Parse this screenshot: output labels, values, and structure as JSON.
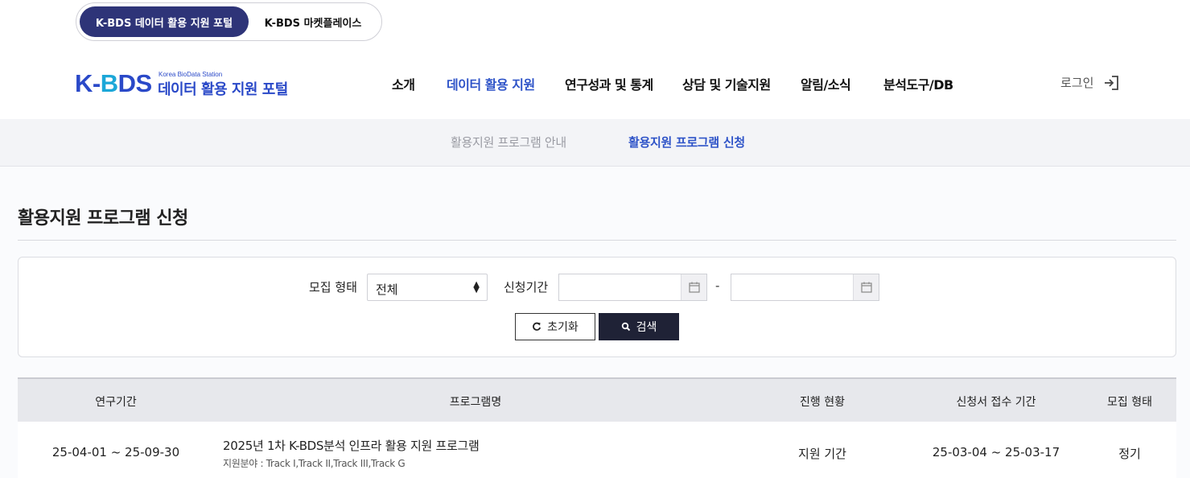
{
  "portal_switch": {
    "active_label": "K-BDS 데이터 활용 지원 포털",
    "other_label": "K-BDS 마켓플레이스"
  },
  "logo": {
    "mark": "K-BDS",
    "english": "Korea BioData Station",
    "korean": "데이터 활용 지원 포털"
  },
  "nav": {
    "items": [
      {
        "label": "소개"
      },
      {
        "label": "데이터 활용 지원"
      },
      {
        "label": "연구성과 및 통계"
      },
      {
        "label": "상담 및 기술지원"
      },
      {
        "label": "알림/소식"
      },
      {
        "label": "분석도구/DB"
      }
    ],
    "active_index": 1,
    "login_label": "로그인"
  },
  "subnav": {
    "items": [
      {
        "label": "활용지원 프로그램 안내"
      },
      {
        "label": "활용지원 프로그램 신청"
      }
    ],
    "active_index": 1
  },
  "page": {
    "title": "활용지원 프로그램 신청"
  },
  "filter": {
    "recruit_type_label": "모집 형태",
    "recruit_type_value": "전체",
    "period_label": "신청기간",
    "start_date": "",
    "end_date": "",
    "separator": "-",
    "reset_label": "초기화",
    "search_label": "검색"
  },
  "table": {
    "headers": [
      "연구기간",
      "프로그램명",
      "진행 현황",
      "신청서 접수 기간",
      "모집 형태"
    ],
    "rows": [
      {
        "period": "25-04-01 ~ 25-09-30",
        "program": "2025년 1차 K-BDS분석 인프라 활용 지원 프로그램",
        "field": "지원분야 : Track I,Track II,Track III,Track G",
        "status": "지원 기간",
        "apply_period": "25-03-04 ~ 25-03-17",
        "recruit_type": "정기"
      }
    ]
  },
  "colors": {
    "brand_navy": "#2e3478",
    "accent_blue": "#2f54c8",
    "logo_blue": "#2a49c8",
    "logo_cyan": "#1ca7d8",
    "search_button": "#1f2236"
  }
}
